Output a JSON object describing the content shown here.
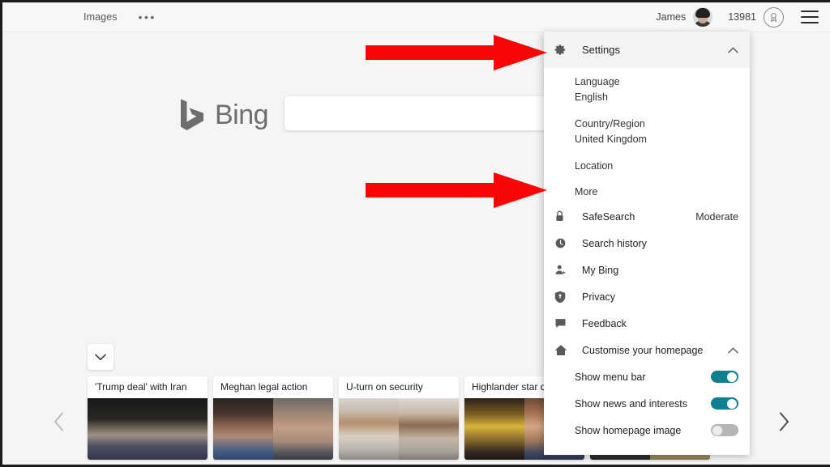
{
  "topbar": {
    "left_links": [
      {
        "label": "Images",
        "name": "top-nav-images"
      },
      {
        "label": "•••",
        "name": "top-nav-more"
      }
    ],
    "user_name": "James",
    "avatar_icon": "user-avatar",
    "rewards_count": "13981",
    "rewards_icon": "rewards-medal-icon",
    "menu_icon": "hamburger-menu-icon"
  },
  "brand": {
    "logo_icon": "bing-logo-icon",
    "name": "Bing"
  },
  "search": {
    "value": "",
    "placeholder": ""
  },
  "news": {
    "expand_icon": "chevron-down-icon",
    "prev_icon": "chevron-left-icon",
    "next_icon": "chevron-right-icon",
    "cards": [
      {
        "title": "'Trump deal' with Iran",
        "image": "boris-johnson-photo"
      },
      {
        "title": "Meghan legal action",
        "image": "meghan-markle-and-thomas-markle-photo"
      },
      {
        "title": "U-turn on security",
        "image": "prince-harry-and-meghan-photo"
      },
      {
        "title": "Highlander star dies",
        "image": "highlander-actor-photo"
      },
      {
        "title": "",
        "image": "partly-hidden-photo"
      }
    ]
  },
  "flyout": {
    "header": {
      "icon": "gear-icon",
      "label": "Settings",
      "chevron": "chevron-up-icon"
    },
    "settings_fields": [
      {
        "label": "Language",
        "value": "English"
      },
      {
        "label": "Country/Region",
        "value": "United Kingdom"
      },
      {
        "label": "Location",
        "value": ""
      },
      {
        "label": "More",
        "value": ""
      }
    ],
    "rows": [
      {
        "icon": "lock-icon",
        "label": "SafeSearch",
        "value": "Moderate"
      },
      {
        "icon": "clock-icon",
        "label": "Search history",
        "value": ""
      },
      {
        "icon": "person-star-icon",
        "label": "My Bing",
        "value": ""
      },
      {
        "icon": "shield-icon",
        "label": "Privacy",
        "value": ""
      },
      {
        "icon": "speech-bubble-icon",
        "label": "Feedback",
        "value": ""
      }
    ],
    "homepage_section": {
      "icon": "home-icon",
      "label": "Customise your homepage",
      "chevron": "chevron-up-icon",
      "toggles": [
        {
          "label": "Show menu bar",
          "state": "on"
        },
        {
          "label": "Show news and interests",
          "state": "on"
        },
        {
          "label": "Show homepage image",
          "state": "off"
        }
      ]
    }
  },
  "annotations": {
    "arrows": [
      {
        "name": "arrow-to-settings",
        "color": "#fa0505",
        "points_to": "Settings"
      },
      {
        "name": "arrow-to-more",
        "color": "#fa0505",
        "points_to": "More"
      }
    ]
  },
  "colors": {
    "toggle_on": "#0f7f92",
    "toggle_off": "#b6b6b6",
    "arrow_red": "#fa0505",
    "page_bg": "#f5f5f5"
  }
}
